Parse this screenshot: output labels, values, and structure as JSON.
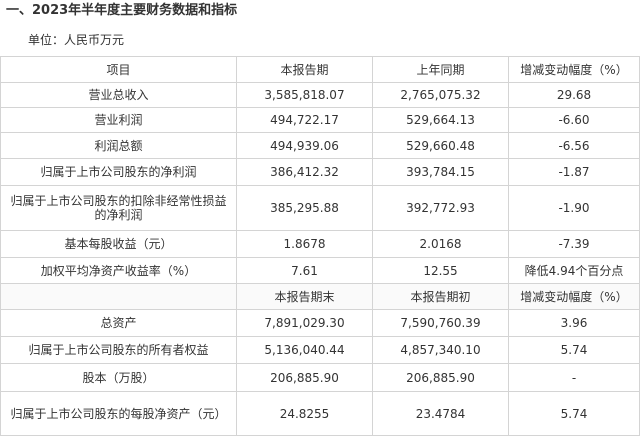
{
  "header": {
    "title": "一、2023年半年度主要财务数据和指标",
    "unit": "单位：人民币万元"
  },
  "table": {
    "rows": [
      {
        "cells": [
          "项目",
          "本报告期",
          "上年同期",
          "增减变动幅度（%）"
        ]
      },
      {
        "cells": [
          "营业总收入",
          "3,585,818.07",
          "2,765,075.32",
          "29.68"
        ]
      },
      {
        "cells": [
          "营业利润",
          "494,722.17",
          "529,664.13",
          "-6.60"
        ]
      },
      {
        "cells": [
          "利润总额",
          "494,939.06",
          "529,660.48",
          "-6.56"
        ]
      },
      {
        "cells": [
          "归属于上市公司股东的净利润",
          "386,412.32",
          "393,784.15",
          "-1.87"
        ]
      },
      {
        "cells": [
          "归属于上市公司股东的扣除非经常性损益的净利润",
          "385,295.88",
          "392,772.93",
          "-1.90"
        ]
      },
      {
        "cells": [
          "基本每股收益（元）",
          "1.8678",
          "2.0168",
          "-7.39"
        ]
      },
      {
        "cells": [
          "加权平均净资产收益率（%）",
          "7.61",
          "12.55",
          "降低4.94个百分点"
        ]
      },
      {
        "cells": [
          "",
          "本报告期末",
          "本报告期初",
          "增减变动幅度（%）"
        ]
      },
      {
        "cells": [
          "总资产",
          "7,891,029.30",
          "7,590,760.39",
          "3.96"
        ]
      },
      {
        "cells": [
          "归属于上市公司股东的所有者权益",
          "5,136,040.44",
          "4,857,340.10",
          "5.74"
        ]
      },
      {
        "cells": [
          "股本（万股）",
          "206,885.90",
          "206,885.90",
          "-"
        ]
      },
      {
        "cells": [
          "归属于上市公司股东的每股净资产（元）",
          "24.8255",
          "23.4784",
          "5.74"
        ]
      }
    ]
  }
}
